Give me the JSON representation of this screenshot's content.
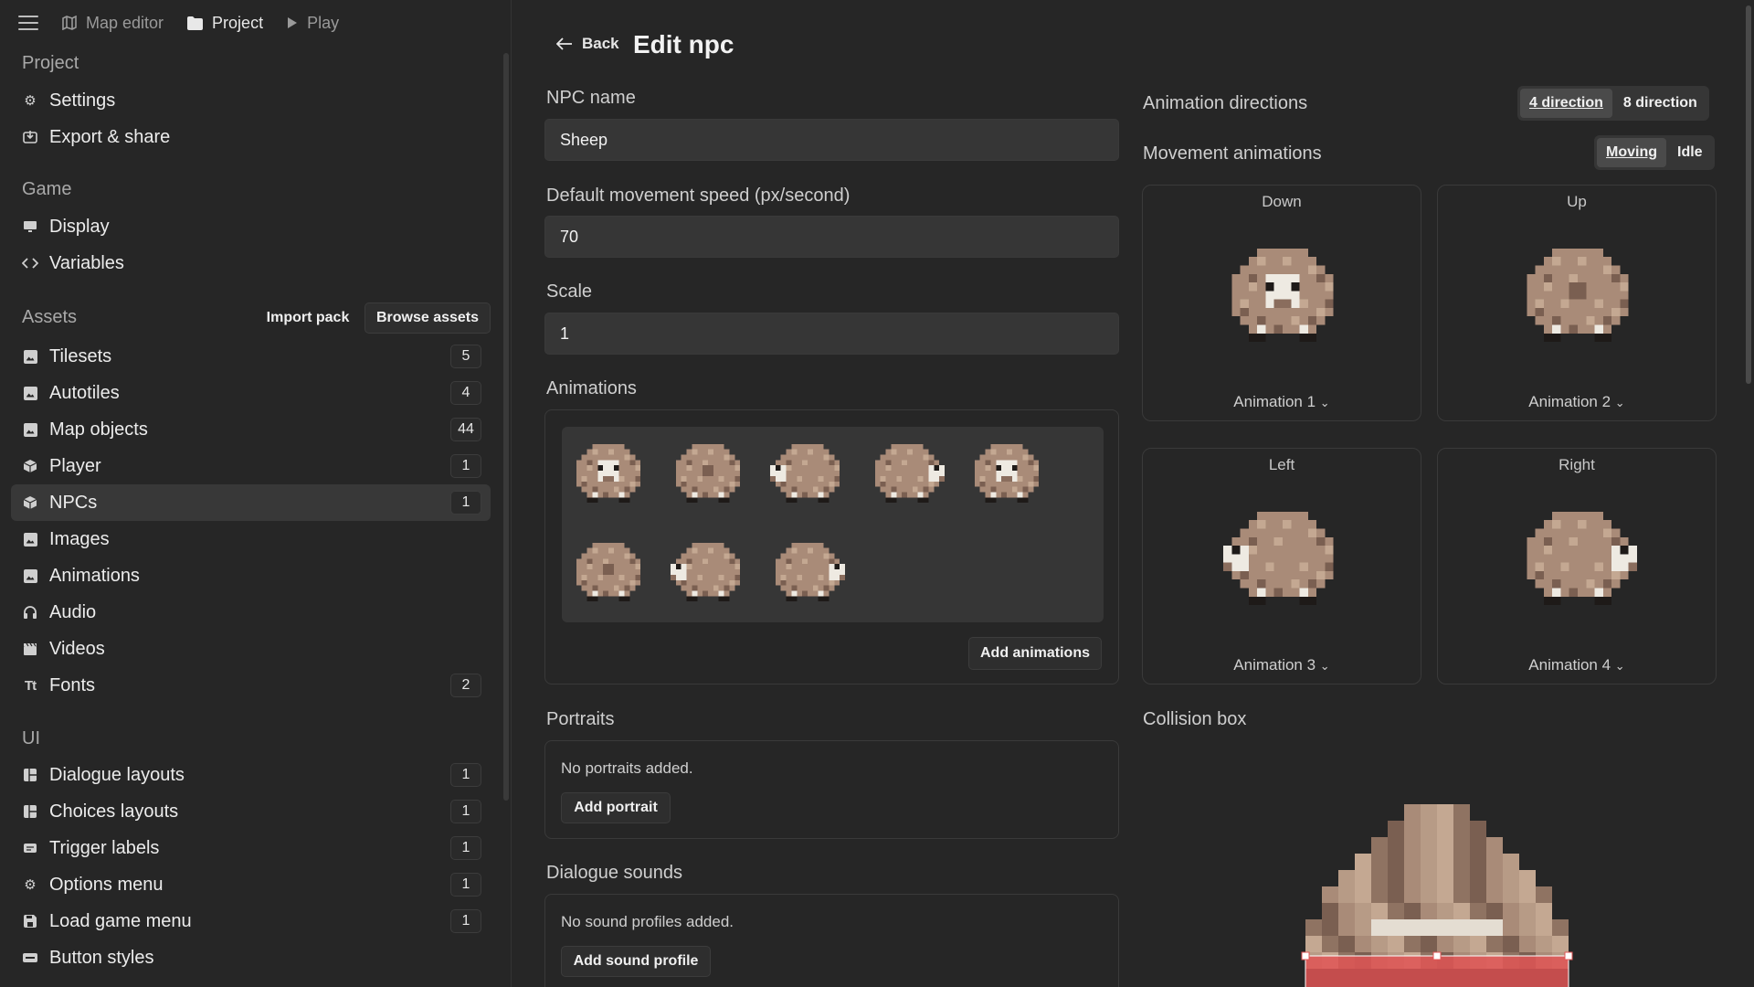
{
  "topnav": {
    "items": [
      {
        "label": "Map editor",
        "icon": "map-icon"
      },
      {
        "label": "Project",
        "icon": "folder-icon"
      },
      {
        "label": "Play",
        "icon": "play-icon"
      }
    ]
  },
  "sidebar": {
    "project_title": "Project",
    "project_items": [
      {
        "label": "Settings",
        "icon": "gear-icon"
      },
      {
        "label": "Export & share",
        "icon": "export-icon"
      }
    ],
    "game_title": "Game",
    "game_items": [
      {
        "label": "Display",
        "icon": "monitor-icon"
      },
      {
        "label": "Variables",
        "icon": "code-icon"
      }
    ],
    "assets_title": "Assets",
    "import_pack": "Import pack",
    "browse_assets": "Browse assets",
    "asset_items": [
      {
        "label": "Tilesets",
        "count": "5",
        "icon": "image-icon"
      },
      {
        "label": "Autotiles",
        "count": "4",
        "icon": "image-icon"
      },
      {
        "label": "Map objects",
        "count": "44",
        "icon": "image-icon"
      },
      {
        "label": "Player",
        "count": "1",
        "icon": "cube-icon"
      },
      {
        "label": "NPCs",
        "count": "1",
        "icon": "cube-icon"
      },
      {
        "label": "Images",
        "count": "",
        "icon": "image-icon"
      },
      {
        "label": "Animations",
        "count": "",
        "icon": "image-icon"
      },
      {
        "label": "Audio",
        "count": "",
        "icon": "headphones-icon"
      },
      {
        "label": "Videos",
        "count": "",
        "icon": "clapper-icon"
      },
      {
        "label": "Fonts",
        "count": "2",
        "icon": "text-icon"
      }
    ],
    "ui_title": "UI",
    "ui_items": [
      {
        "label": "Dialogue layouts",
        "count": "1",
        "icon": "layout-icon"
      },
      {
        "label": "Choices layouts",
        "count": "1",
        "icon": "layout-icon"
      },
      {
        "label": "Trigger labels",
        "count": "1",
        "icon": "label-icon"
      },
      {
        "label": "Options menu",
        "count": "1",
        "icon": "gear-icon"
      },
      {
        "label": "Load game menu",
        "count": "1",
        "icon": "save-icon"
      },
      {
        "label": "Button styles",
        "count": "",
        "icon": "button-icon"
      }
    ]
  },
  "main": {
    "back": "Back",
    "title": "Edit npc",
    "npc_name_label": "NPC name",
    "npc_name_value": "Sheep",
    "speed_label": "Default movement speed (px/second)",
    "speed_value": "70",
    "scale_label": "Scale",
    "scale_value": "1",
    "animations_label": "Animations",
    "add_animations": "Add animations",
    "portraits_label": "Portraits",
    "no_portraits": "No portraits added.",
    "add_portrait": "Add portrait",
    "dialogue_sounds_label": "Dialogue sounds",
    "no_sounds": "No sound profiles added.",
    "add_sound_profile": "Add sound profile",
    "anim_directions_label": "Animation directions",
    "dir_opt_4": "4 direction",
    "dir_opt_8": "8 direction",
    "movement_label": "Movement animations",
    "move_opt_moving": "Moving",
    "move_opt_idle": "Idle",
    "cards": [
      {
        "title": "Down",
        "animation": "Animation 1"
      },
      {
        "title": "Up",
        "animation": "Animation 2"
      },
      {
        "title": "Left",
        "animation": "Animation 3"
      },
      {
        "title": "Right",
        "animation": "Animation 4"
      }
    ],
    "collision_label": "Collision box"
  },
  "colors": {
    "bg": "#262626",
    "input": "#363636",
    "wool": "#a98b78",
    "collision": "#e05555"
  }
}
